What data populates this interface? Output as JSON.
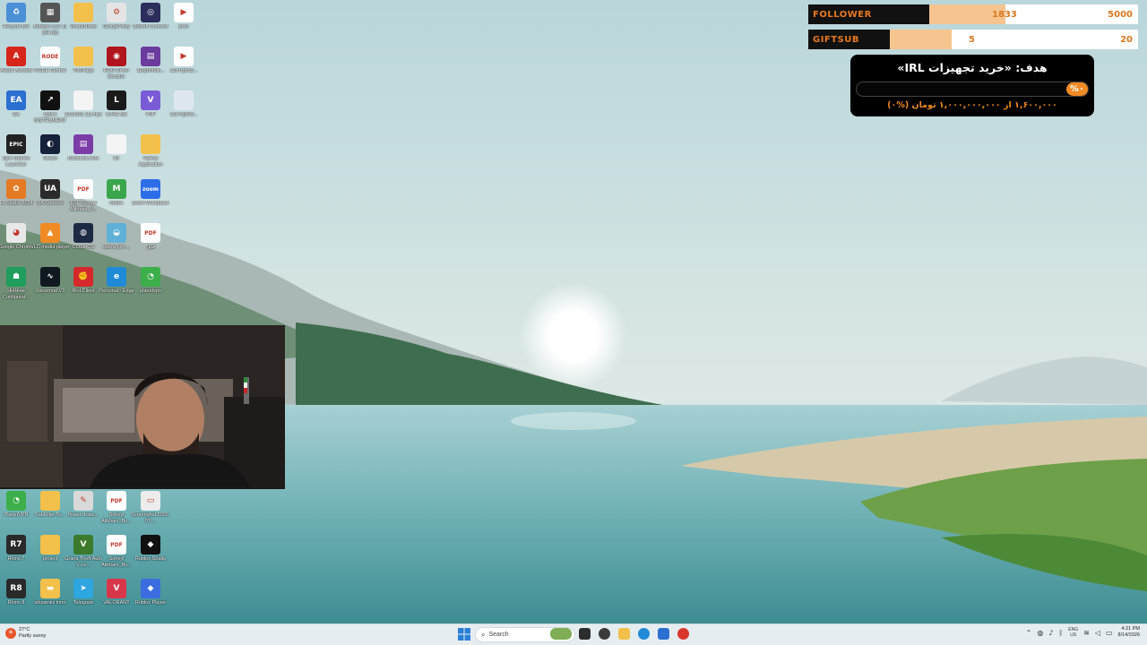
{
  "overlay": {
    "follower": {
      "label": "FOLLOWER",
      "current": "1833",
      "target": "5000",
      "progress": 0.3666
    },
    "giftsub": {
      "label": "GIFTSUB",
      "current": "5",
      "target": "20",
      "progress": 0.25
    },
    "goal": {
      "title": "هدف: «خرید تجهیزات IRL»",
      "percent": "%۰",
      "progress": 0,
      "amount": "۱,۶۰۰,۰۰۰ از ۱,۰۰۰,۰۰۰,۰۰۰ تومان (%۰)"
    }
  },
  "desktop_icons": [
    {
      "label": "Recycle Bin",
      "color": "#4b8fd6",
      "glyph": "♻",
      "name": "recycle-bin-icon"
    },
    {
      "label": "Ableton Live 11 (64-bit)",
      "color": "#555555",
      "glyph": "▦",
      "name": "ableton-icon"
    },
    {
      "label": "VirtualNmes",
      "color": "#f3c14b",
      "glyph": "",
      "name": "folder-icon"
    },
    {
      "label": "GroupPolicy",
      "color": "#e4e4e4",
      "glyph": "⚙",
      "name": "group-policy-icon"
    },
    {
      "label": "Ubisoft Connect",
      "color": "#2b2d5a",
      "glyph": "◎",
      "name": "ubisoft-icon"
    },
    {
      "label": "pmo",
      "color": "#ffffff",
      "glyph": "▶",
      "name": "video-file-icon"
    },
    {
      "label": "Adobe Acrobat",
      "color": "#d6261c",
      "glyph": "A",
      "name": "acrobat-icon"
    },
    {
      "label": "RODE Central",
      "color": "#ffffff",
      "glyph": "RODE",
      "name": "rode-icon"
    },
    {
      "label": "VIMPapp",
      "color": "#f3c14b",
      "glyph": "",
      "name": "folder-icon"
    },
    {
      "label": "ROG Driver Booster",
      "color": "#b0141c",
      "glyph": "◉",
      "name": "rog-icon"
    },
    {
      "label": "12rghnhdk...",
      "color": "#6c3b9e",
      "glyph": "▤",
      "name": "winrar-icon"
    },
    {
      "label": "12n7rghd3...",
      "color": "#ffffff",
      "glyph": "▶",
      "name": "video-file-icon"
    },
    {
      "label": "EA",
      "color": "#2b6fd1",
      "glyph": "EA",
      "name": "ea-icon"
    },
    {
      "label": "Splice INSTRUMENT",
      "color": "#111111",
      "glyph": "↗",
      "name": "splice-icon"
    },
    {
      "label": "2213201 (1).mps",
      "color": "#f4f4f4",
      "glyph": "",
      "name": "file-icon"
    },
    {
      "label": "LUKE Biz",
      "color": "#1a1a1a",
      "glyph": "L",
      "name": "luke-icon"
    },
    {
      "label": "YNP",
      "color": "#7a5bd6",
      "glyph": "V",
      "name": "vnp-icon"
    },
    {
      "label": "12n7rghd3...",
      "color": "#dfe7ee",
      "glyph": "",
      "name": "file-icon"
    },
    {
      "label": "Epic Games Launcher",
      "color": "#222222",
      "glyph": "EPIC",
      "name": "epic-games-icon"
    },
    {
      "label": "Steam",
      "color": "#16213a",
      "glyph": "◐",
      "name": "steam-icon"
    },
    {
      "label": "BookLink.elva",
      "color": "#7b3ca8",
      "glyph": "▤",
      "name": "winrar-icon"
    },
    {
      "label": "Dir",
      "color": "#f4f4f4",
      "glyph": "",
      "name": "text-file-icon"
    },
    {
      "label": "Videos Application",
      "color": "#f3c14b",
      "glyph": "",
      "name": "folder-icon"
    },
    {
      "label": "FL Studio 2024",
      "color": "#e57a24",
      "glyph": "✿",
      "name": "fl-studio-icon"
    },
    {
      "label": "UA Connect",
      "color": "#2b2b2b",
      "glyph": "UA",
      "name": "ua-connect-icon"
    },
    {
      "label": "ESF Soheyl Alikhani_V...",
      "color": "#ffffff",
      "glyph": "PDF",
      "name": "pdf-icon"
    },
    {
      "label": "Matrix",
      "color": "#3aa64b",
      "glyph": "M",
      "name": "matrix-icon"
    },
    {
      "label": "Zoom Workplace",
      "color": "#2d6ee8",
      "glyph": "zoom",
      "name": "zoom-icon"
    },
    {
      "label": "Google Chrome",
      "color": "#e8e8e8",
      "glyph": "◕",
      "name": "chrome-icon"
    },
    {
      "label": "VLC media player",
      "color": "#f08a24",
      "glyph": "▲",
      "name": "vlc-icon"
    },
    {
      "label": "COSMOS",
      "color": "#1c2a44",
      "glyph": "◍",
      "name": "cosmos-icon"
    },
    {
      "label": "opera pro-...",
      "color": "#5fb0d6",
      "glyph": "◒",
      "name": "app-icon"
    },
    {
      "label": "فایل",
      "color": "#ffffff",
      "glyph": "PDF",
      "name": "pdf-icon"
    },
    {
      "label": "HidHide Configurat...",
      "color": "#1f9d5c",
      "glyph": "☗",
      "name": "hidhide-icon"
    },
    {
      "label": "Voicemod V3",
      "color": "#101820",
      "glyph": "∿",
      "name": "voicemod-icon"
    },
    {
      "label": "Riot Client",
      "color": "#d4282c",
      "glyph": "✊",
      "name": "riot-icon"
    },
    {
      "label": "Personal - Edge",
      "color": "#1f8ad6",
      "glyph": "e",
      "name": "edge-icon"
    },
    {
      "label": "planetvpn",
      "color": "#3cae4a",
      "glyph": "◔",
      "name": "planetvpn-icon"
    },
    {
      "label": "PlanetVPN",
      "color": "#3cae4a",
      "glyph": "◔",
      "name": "planetvpn-icon"
    },
    {
      "label": "FabFilter.To...",
      "color": "#f3c14b",
      "glyph": "",
      "name": "folder-icon"
    },
    {
      "label": "flower drawi...",
      "color": "#d9d9d9",
      "glyph": "✎",
      "name": "image-file-icon"
    },
    {
      "label": "Soheyl Alikhani_Bu...",
      "color": "#ffffff",
      "glyph": "PDF",
      "name": "pdf-icon"
    },
    {
      "label": "Screenshot 2026-07-...",
      "color": "#ececec",
      "glyph": "▭",
      "name": "image-file-icon"
    },
    {
      "label": "Rhino 7",
      "color": "#2a2a2a",
      "glyph": "R7",
      "name": "rhino-icon"
    },
    {
      "label": "project",
      "color": "#f3c14b",
      "glyph": "",
      "name": "folder-icon"
    },
    {
      "label": "Grand Theft Auto V Le...",
      "color": "#3b7a2b",
      "glyph": "V",
      "name": "gta-icon"
    },
    {
      "label": "Soheyl Alikhani_Bu...",
      "color": "#ffffff",
      "glyph": "PDF",
      "name": "pdf-icon"
    },
    {
      "label": "Roblox Studio",
      "color": "#111111",
      "glyph": "◆",
      "name": "roblox-studio-icon"
    },
    {
      "label": "Rhino 8",
      "color": "#2a2a2a",
      "glyph": "R8",
      "name": "rhino-icon"
    },
    {
      "label": "sibzamini intro",
      "color": "#f3c14b",
      "glyph": "▬",
      "name": "folder-icon"
    },
    {
      "label": "Telegram",
      "color": "#2ea6e0",
      "glyph": "➤",
      "name": "telegram-icon"
    },
    {
      "label": "VALORANT",
      "color": "#d8364a",
      "glyph": "V",
      "name": "valorant-icon"
    },
    {
      "label": "Roblox Player",
      "color": "#3b6de0",
      "glyph": "◆",
      "name": "roblox-icon"
    }
  ],
  "taskbar": {
    "weather_temp": "27°C",
    "weather_desc": "Partly sunny",
    "search_placeholder": "Search",
    "lang_top": "ENG",
    "lang_bottom": "US",
    "time": "4:21 PM",
    "date": "8/14/2026",
    "colors": {
      "start": "#2b7fd6",
      "accent": "#f08a24"
    }
  }
}
